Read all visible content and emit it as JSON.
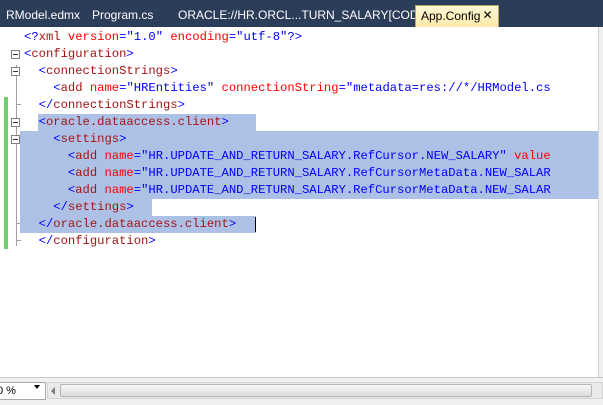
{
  "tabs": [
    {
      "label": "RModel.edmx",
      "active": false
    },
    {
      "label": "Program.cs",
      "active": false
    },
    {
      "label": "ORACLE://HR.ORCL...TURN_SALARY[CODE]",
      "active": false
    },
    {
      "label": "App.Config",
      "active": true
    }
  ],
  "tab_close_glyph": "✕",
  "code_lines": [
    [
      {
        "c": "pi",
        "t": "<?"
      },
      {
        "c": "tag",
        "t": "xml"
      },
      {
        "c": "att",
        "t": " version"
      },
      {
        "c": "pi",
        "t": "="
      },
      {
        "c": "val",
        "t": "\"1.0\""
      },
      {
        "c": "att",
        "t": " encoding"
      },
      {
        "c": "pi",
        "t": "="
      },
      {
        "c": "val",
        "t": "\"utf-8\""
      },
      {
        "c": "pi",
        "t": "?>"
      }
    ],
    [
      {
        "c": "br",
        "t": "<"
      },
      {
        "c": "tag",
        "t": "configuration"
      },
      {
        "c": "br",
        "t": ">"
      }
    ],
    [
      {
        "c": "txt",
        "t": "  "
      },
      {
        "c": "br",
        "t": "<"
      },
      {
        "c": "tag",
        "t": "connectionStrings"
      },
      {
        "c": "br",
        "t": ">"
      }
    ],
    [
      {
        "c": "txt",
        "t": "    "
      },
      {
        "c": "br",
        "t": "<"
      },
      {
        "c": "tag",
        "t": "add"
      },
      {
        "c": "att",
        "t": " name"
      },
      {
        "c": "br",
        "t": "="
      },
      {
        "c": "val",
        "t": "\"HREntities\""
      },
      {
        "c": "att",
        "t": " connectionString"
      },
      {
        "c": "br",
        "t": "="
      },
      {
        "c": "val",
        "t": "\"metadata=res://*/HRModel.cs"
      }
    ],
    [
      {
        "c": "txt",
        "t": "  "
      },
      {
        "c": "br",
        "t": "</"
      },
      {
        "c": "tag",
        "t": "connectionStrings"
      },
      {
        "c": "br",
        "t": ">"
      }
    ],
    [
      {
        "c": "txt",
        "t": "  "
      },
      {
        "c": "br",
        "t": "<"
      },
      {
        "c": "tag",
        "t": "oracle.dataaccess.client"
      },
      {
        "c": "br",
        "t": ">"
      }
    ],
    [
      {
        "c": "txt",
        "t": "    "
      },
      {
        "c": "br",
        "t": "<"
      },
      {
        "c": "tag",
        "t": "settings"
      },
      {
        "c": "br",
        "t": ">"
      }
    ],
    [
      {
        "c": "txt",
        "t": "      "
      },
      {
        "c": "br",
        "t": "<"
      },
      {
        "c": "tag",
        "t": "add"
      },
      {
        "c": "att",
        "t": " name"
      },
      {
        "c": "br",
        "t": "="
      },
      {
        "c": "val",
        "t": "\"HR.UPDATE_AND_RETURN_SALARY.RefCursor.NEW_SALARY\""
      },
      {
        "c": "att",
        "t": " value"
      }
    ],
    [
      {
        "c": "txt",
        "t": "      "
      },
      {
        "c": "br",
        "t": "<"
      },
      {
        "c": "tag",
        "t": "add"
      },
      {
        "c": "att",
        "t": " name"
      },
      {
        "c": "br",
        "t": "="
      },
      {
        "c": "val",
        "t": "\"HR.UPDATE_AND_RETURN_SALARY.RefCursorMetaData.NEW_SALAR"
      }
    ],
    [
      {
        "c": "txt",
        "t": "      "
      },
      {
        "c": "br",
        "t": "<"
      },
      {
        "c": "tag",
        "t": "add"
      },
      {
        "c": "att",
        "t": " name"
      },
      {
        "c": "br",
        "t": "="
      },
      {
        "c": "val",
        "t": "\"HR.UPDATE_AND_RETURN_SALARY.RefCursorMetaData.NEW_SALAR"
      }
    ],
    [
      {
        "c": "txt",
        "t": "    "
      },
      {
        "c": "br",
        "t": "</"
      },
      {
        "c": "tag",
        "t": "settings"
      },
      {
        "c": "br",
        "t": ">"
      }
    ],
    [
      {
        "c": "txt",
        "t": "  "
      },
      {
        "c": "br",
        "t": "</"
      },
      {
        "c": "tag",
        "t": "oracle.dataaccess.client"
      },
      {
        "c": "br",
        "t": ">"
      }
    ],
    [
      {
        "c": "txt",
        "t": "  "
      },
      {
        "c": "br",
        "t": "</"
      },
      {
        "c": "tag",
        "t": "configuration"
      },
      {
        "c": "br",
        "t": ">"
      }
    ]
  ],
  "selection": {
    "first_line": 6,
    "last_line": 12
  },
  "zoom": {
    "value": "0 %"
  },
  "colors": {
    "tab_strip": "#2c3d5a",
    "active_tab": "#ffe9a8",
    "selection": "#adc1e7",
    "change_bar": "#6fcf6f",
    "xml_delimiter": "#0000ff",
    "xml_element": "#a31515",
    "xml_attribute": "#ff0000",
    "xml_value": "#0000ff"
  }
}
